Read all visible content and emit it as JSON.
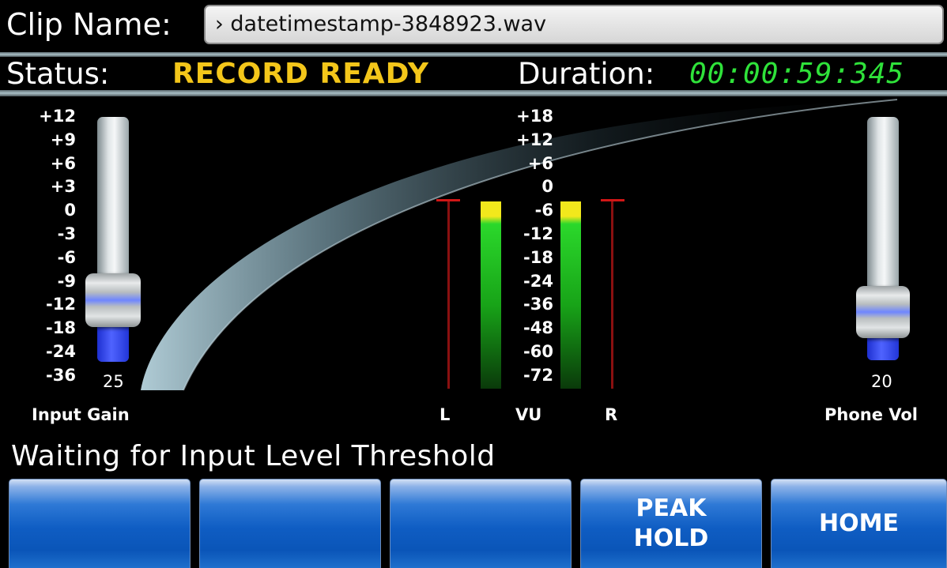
{
  "header": {
    "clip_label": "Clip Name:",
    "clip_value": "› datetimestamp-3848923.wav",
    "status_label": "Status:",
    "status_value": "RECORD READY",
    "duration_label": "Duration:",
    "duration_value": "00:00:59:345"
  },
  "colors": {
    "status_value": "#f3c61a",
    "duration_value": "#2fe23a",
    "button_blue": "#0f5dc3"
  },
  "input_gain": {
    "scale": [
      "+12",
      "+9",
      "+6",
      "+3",
      "0",
      "-3",
      "-6",
      "-9",
      "-12",
      "-18",
      "-24",
      "-36"
    ],
    "value": "25",
    "caption": "Input Gain"
  },
  "vu": {
    "scale": [
      "+18",
      "+12",
      "+6",
      "0",
      "-6",
      "-12",
      "-18",
      "-24",
      "-36",
      "-48",
      "-60",
      "-72"
    ],
    "left_label": "L",
    "center_label": "VU",
    "right_label": "R"
  },
  "phone_vol": {
    "value": "20",
    "caption": "Phone Vol"
  },
  "message": "Waiting for Input Level Threshold",
  "buttons": [
    {
      "label": ""
    },
    {
      "label": ""
    },
    {
      "label": ""
    },
    {
      "label": "PEAK\nHOLD"
    },
    {
      "label": "HOME"
    }
  ]
}
